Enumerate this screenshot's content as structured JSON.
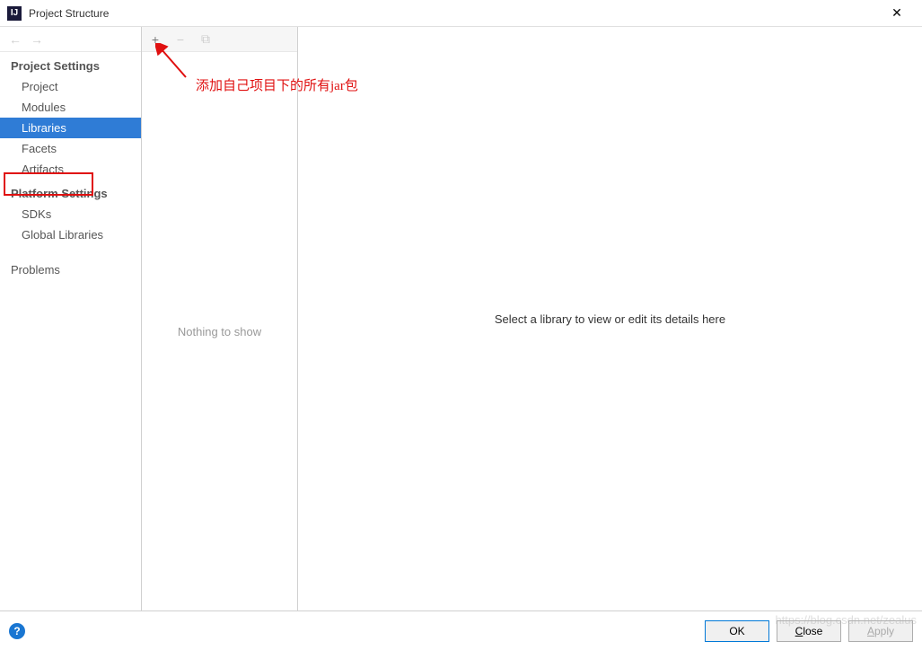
{
  "window": {
    "title": "Project Structure",
    "icon_label": "IJ"
  },
  "sidebar": {
    "sections": [
      {
        "header": "Project Settings",
        "items": [
          "Project",
          "Modules",
          "Libraries",
          "Facets",
          "Artifacts"
        ]
      },
      {
        "header": "Platform Settings",
        "items": [
          "SDKs",
          "Global Libraries"
        ]
      }
    ],
    "problems_label": "Problems",
    "selected": "Libraries"
  },
  "toolbar": {
    "add_icon": "+",
    "remove_icon": "−",
    "copy_icon": "⧉"
  },
  "middle": {
    "empty_text": "Nothing to show"
  },
  "detail": {
    "placeholder": "Select a library to view or edit its details here"
  },
  "annotation": {
    "text": "添加自己项目下的所有jar包"
  },
  "footer": {
    "ok": "OK",
    "close": "Close",
    "apply": "Apply"
  },
  "watermark": "https://blog.csdn.net/zealus"
}
